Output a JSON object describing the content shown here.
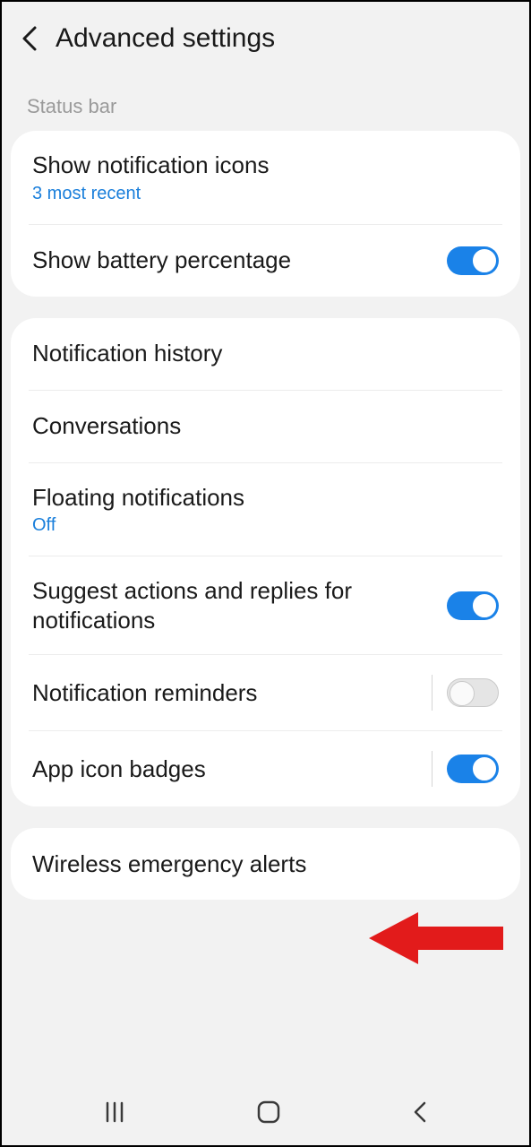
{
  "header": {
    "title": "Advanced settings"
  },
  "sections": {
    "status_bar_label": "Status bar"
  },
  "group1": {
    "show_notification_icons": {
      "title": "Show notification icons",
      "subtitle": "3 most recent"
    },
    "show_battery_percentage": {
      "title": "Show battery percentage",
      "toggle": true
    }
  },
  "group2": {
    "notification_history": {
      "title": "Notification history"
    },
    "conversations": {
      "title": "Conversations"
    },
    "floating_notifications": {
      "title": "Floating notifications",
      "subtitle": "Off"
    },
    "suggest_actions": {
      "title": "Suggest actions and replies for notifications",
      "toggle": true
    },
    "notification_reminders": {
      "title": "Notification reminders",
      "toggle": false
    },
    "app_icon_badges": {
      "title": "App icon badges",
      "toggle": true
    }
  },
  "group3": {
    "wireless_emergency_alerts": {
      "title": "Wireless emergency alerts"
    }
  },
  "colors": {
    "accent": "#1a82e8",
    "link": "#1a7fdb",
    "annotation_arrow": "#e21b1b"
  }
}
